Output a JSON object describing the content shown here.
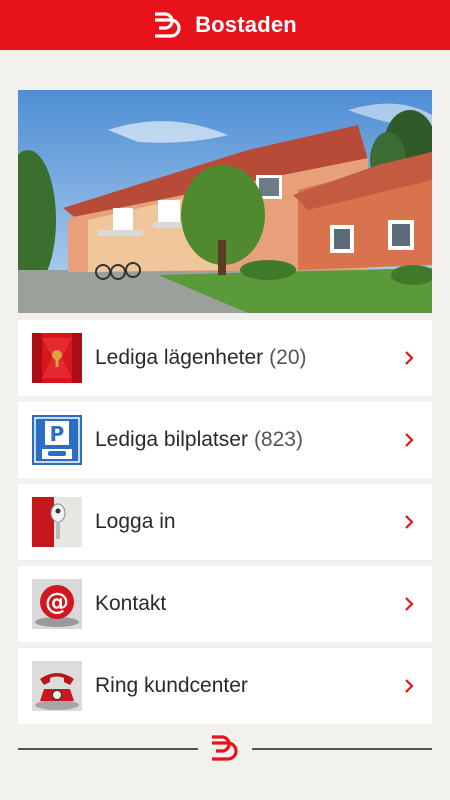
{
  "header": {
    "title": "Bostaden",
    "brand_color": "#e8121b",
    "logo_icon": "bostaden-logo-icon"
  },
  "hero": {
    "image": "residential-buildings-photo"
  },
  "menu": {
    "items": [
      {
        "label": "Lediga lägenheter",
        "count": "(20)",
        "icon": "door-keyhole-icon"
      },
      {
        "label": "Lediga bilplatser",
        "count": "(823)",
        "icon": "parking-sign-icon"
      },
      {
        "label": "Logga in",
        "count": "",
        "icon": "key-icon"
      },
      {
        "label": "Kontakt",
        "count": "",
        "icon": "at-sign-icon"
      },
      {
        "label": "Ring kundcenter",
        "count": "",
        "icon": "telephone-icon"
      }
    ],
    "chevron_color": "#e8121b"
  },
  "footer": {
    "logo_icon": "bostaden-logo-icon"
  }
}
